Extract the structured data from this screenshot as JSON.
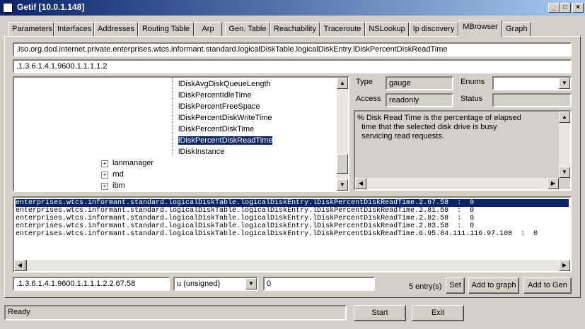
{
  "window": {
    "title": "Getif [10.0.1.148]",
    "minimize": "_",
    "maximize": "□",
    "close": "×"
  },
  "tabs": [
    {
      "label": "Parameters"
    },
    {
      "label": "Interfaces"
    },
    {
      "label": "Addresses"
    },
    {
      "label": "Routing Table"
    },
    {
      "label": "Arp"
    },
    {
      "label": "Gen. Table"
    },
    {
      "label": "Reachability"
    },
    {
      "label": "Traceroute"
    },
    {
      "label": "NSLookup"
    },
    {
      "label": "Ip discovery"
    },
    {
      "label": "MBrowser"
    },
    {
      "label": "Graph"
    }
  ],
  "mbrowser": {
    "oid_name": ".iso.org.dod.internet.private.enterprises.wtcs.informant.standard.logicalDiskTable.logicalDiskEntry.lDiskPercentDiskReadTime",
    "oid_numeric": ".1.3.6.1.4.1.9600.1.1.1.1.2",
    "tree": {
      "items": [
        "lDiskAvgDiskQueueLength",
        "lDiskPercentIdleTime",
        "lDiskPercentFreeSpace",
        "lDiskPercentDiskWriteTime",
        "lDiskPercentDiskTime",
        "lDiskPercentDiskReadTime",
        "lDiskInstance"
      ],
      "folders": [
        "lanmanager",
        "rnd",
        "ibm"
      ]
    },
    "type_label": "Type",
    "type_value": "gauge",
    "enums_label": "Enums",
    "access_label": "Access",
    "access_value": "readonly",
    "status_label": "Status",
    "status_value": "",
    "description": "% Disk Read Time is the percentage of elapsed\n  time that the selected disk drive is busy\n  servicing read requests.",
    "results": [
      "enterprises.wtcs.informant.standard.logicalDiskTable.logicalDiskEntry.lDiskPercentDiskReadTime.2.67.58  :  0",
      "enterprises.wtcs.informant.standard.logicalDiskTable.logicalDiskEntry.lDiskPercentDiskReadTime.2.81.58  :  0",
      "enterprises.wtcs.informant.standard.logicalDiskTable.logicalDiskEntry.lDiskPercentDiskReadTime.2.82.58  :  0",
      "enterprises.wtcs.informant.standard.logicalDiskTable.logicalDiskEntry.lDiskPercentDiskReadTime.2.83.58  :  0",
      "enterprises.wtcs.informant.standard.logicalDiskTable.logicalDiskEntry.lDiskPercentDiskReadTime.6.95.84.111.116.97.108  :  0"
    ],
    "set_oid": ".1.3.6.1.4.1.9600.1.1.1.1.2.2.67.58",
    "set_type": "u (unsigned)",
    "set_value": "0",
    "entry_count": "5 entry(s)",
    "set_button": "Set",
    "add_graph_button": "Add to graph",
    "add_gen_button": "Add to Gen"
  },
  "statusbar": {
    "text": "Ready"
  },
  "buttons": {
    "start": "Start",
    "exit": "Exit"
  },
  "colors": {
    "title_start": "#0a246a",
    "title_end": "#a6caf0",
    "face": "#d4d0c8",
    "selection": "#0a246a"
  }
}
